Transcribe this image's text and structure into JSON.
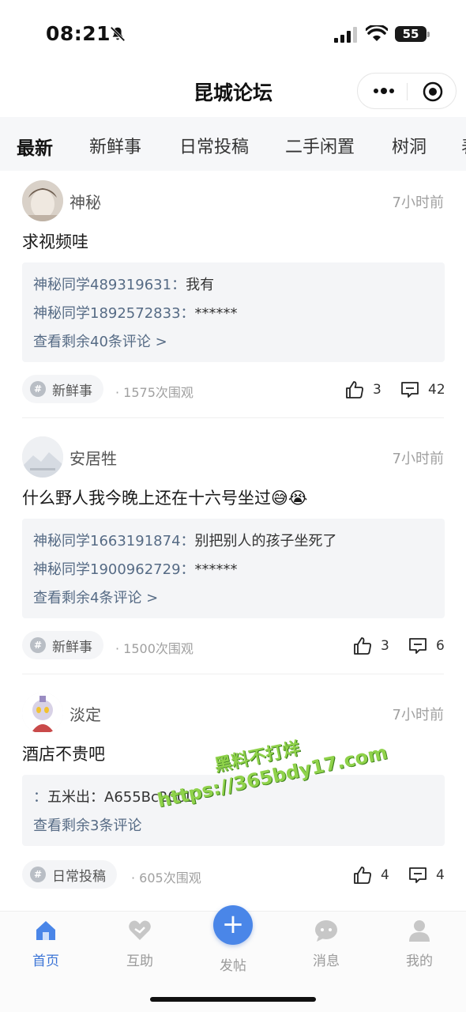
{
  "status_bar": {
    "time": "08:21",
    "battery": "55"
  },
  "nav": {
    "title": "昆城论坛"
  },
  "tabs": [
    {
      "label": "最新",
      "active": true
    },
    {
      "label": "新鲜事"
    },
    {
      "label": "日常投稿"
    },
    {
      "label": "二手闲置"
    },
    {
      "label": "树洞"
    },
    {
      "label": "表"
    }
  ],
  "posts": [
    {
      "author": "神秘",
      "time": "7小时前",
      "content": "求视频哇",
      "comments": [
        {
          "name": "神秘同学489319631：",
          "text": "我有"
        },
        {
          "name": "神秘同学1892572833：",
          "text": "******"
        }
      ],
      "more_comments": "查看剩余40条评论 >",
      "tag": "新鲜事",
      "views": "· 1575次围观",
      "likes": "3",
      "comment_count": "42"
    },
    {
      "author": "安居牲",
      "time": "7小时前",
      "content": "什么野人我今晚上还在十六号坐过😅😭",
      "comments": [
        {
          "name": "神秘同学1663191874：",
          "text": "别把别人的孩子坐死了"
        },
        {
          "name": "神秘同学1900962729：",
          "text": "******"
        }
      ],
      "more_comments": "查看剩余4条评论 >",
      "tag": "新鲜事",
      "views": "· 1500次围观",
      "likes": "3",
      "comment_count": "6"
    },
    {
      "author": "淡定",
      "time": "7小时前",
      "content": "酒店不贵吧",
      "comments": [
        {
          "name": "：",
          "text": "五米出：A655Bc200L"
        }
      ],
      "more_comments": "查看剩余3条评论",
      "tag": "日常投稿",
      "views": "· 605次围观",
      "likes": "4",
      "comment_count": "4"
    }
  ],
  "watermark": {
    "line1": "黑料不打烊",
    "line2": "https://365bdy17.com"
  },
  "tabbar": {
    "items": [
      {
        "label": "首页",
        "active": true
      },
      {
        "label": "互助"
      },
      {
        "label": "发帖"
      },
      {
        "label": "消息"
      },
      {
        "label": "我的"
      }
    ]
  },
  "colors": {
    "accent": "#3b74d6",
    "link": "#566b85",
    "watermark": "#8fd24a"
  }
}
